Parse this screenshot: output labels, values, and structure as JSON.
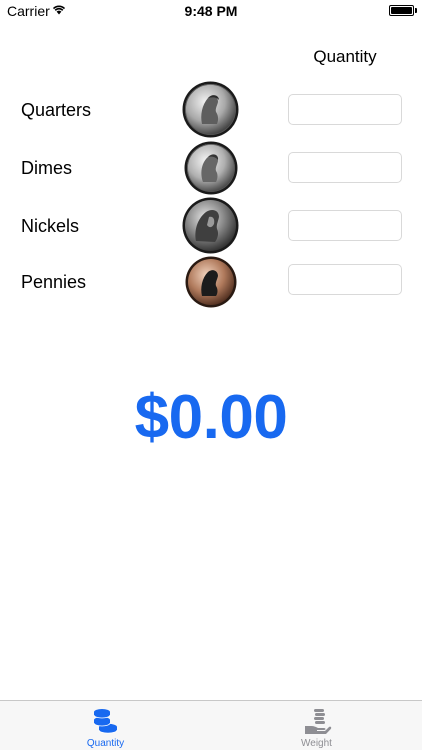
{
  "status_bar": {
    "carrier": "Carrier",
    "time": "9:48 PM"
  },
  "header": {
    "quantity_label": "Quantity"
  },
  "coins": [
    {
      "label": "Quarters",
      "value": "",
      "placeholder": ""
    },
    {
      "label": "Dimes",
      "value": "",
      "placeholder": ""
    },
    {
      "label": "Nickels",
      "value": "",
      "placeholder": ""
    },
    {
      "label": "Pennies",
      "value": "",
      "placeholder": ""
    }
  ],
  "total": "$0.00",
  "tab_bar": {
    "tabs": [
      {
        "label": "Quantity",
        "icon": "coin-stack-icon",
        "selected": true
      },
      {
        "label": "Weight",
        "icon": "hand-coins-icon",
        "selected": false
      }
    ]
  },
  "colors": {
    "accent": "#1869f0",
    "inactive": "#8e8e93"
  }
}
